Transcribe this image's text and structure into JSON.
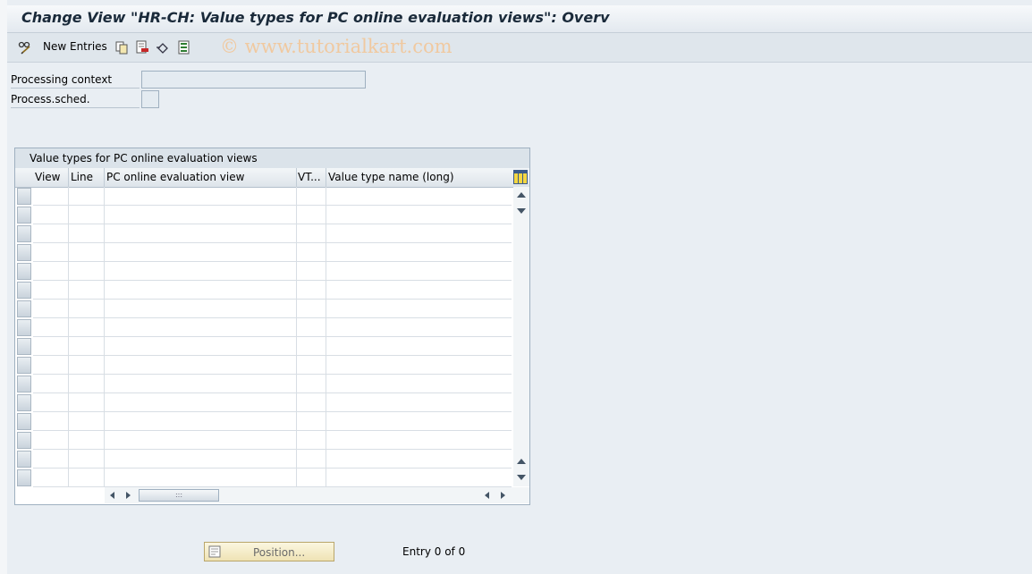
{
  "window": {
    "title": "Change View \"HR-CH: Value types for PC online evaluation views\": Overv"
  },
  "toolbar": {
    "new_entries_label": "New Entries",
    "watermark": "© www.tutorialkart.com",
    "icons": [
      "pencil-glasses-icon",
      "copy-icon",
      "delete-icon",
      "undo-icon",
      "select-all-icon"
    ]
  },
  "fields": {
    "processing_context": {
      "label": "Processing context",
      "value": ""
    },
    "process_sched": {
      "label": "Process.sched.",
      "value": ""
    }
  },
  "table": {
    "title": "Value types for PC online evaluation views",
    "columns": [
      "View",
      "Line",
      "PC online evaluation view",
      "VT...",
      "Value type name (long)"
    ],
    "rows": []
  },
  "footer": {
    "position_button_label": "Position...",
    "entry_text": "Entry 0 of 0"
  },
  "colors": {
    "background": "#e9eef3",
    "watermark": "#f0c9a0",
    "position_button": "#efe3b4"
  }
}
